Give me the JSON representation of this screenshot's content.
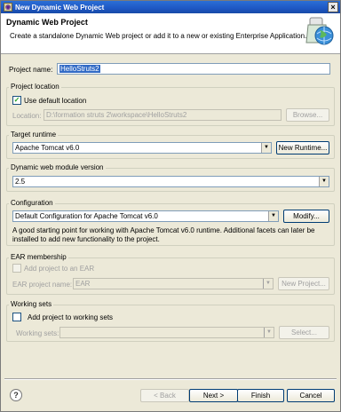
{
  "window": {
    "title": "New Dynamic Web Project"
  },
  "banner": {
    "heading": "Dynamic Web Project",
    "description": "Create a standalone Dynamic Web project or add it to a new or existing Enterprise Application."
  },
  "project_name": {
    "label": "Project name:",
    "value": "HelloStruts2"
  },
  "project_location": {
    "title": "Project location",
    "use_default_label": "Use default location",
    "use_default_checked": true,
    "location_label": "Location:",
    "location_value": "D:\\formation struts 2\\workspace\\HelloStruts2",
    "browse_label": "Browse..."
  },
  "target_runtime": {
    "title": "Target runtime",
    "value": "Apache Tomcat v6.0",
    "new_runtime_label": "New Runtime..."
  },
  "module_version": {
    "title": "Dynamic web module version",
    "value": "2.5"
  },
  "configuration": {
    "title": "Configuration",
    "value": "Default Configuration for Apache Tomcat v6.0",
    "modify_label": "Modify...",
    "info_line1": "A good starting point for working with Apache Tomcat v6.0 runtime. Additional facets can later be",
    "info_line2": "installed to add new functionality to the project."
  },
  "ear": {
    "title": "EAR membership",
    "add_label": "Add project to an EAR",
    "ear_name_label": "EAR project name:",
    "ear_value": "EAR",
    "new_project_label": "New Project..."
  },
  "working_sets": {
    "title": "Working sets",
    "add_label": "Add project to working sets",
    "sets_label": "Working sets:",
    "sets_value": "",
    "select_label": "Select..."
  },
  "footer": {
    "help": "?",
    "back_label": "< Back",
    "next_label": "Next >",
    "finish_label": "Finish",
    "cancel_label": "Cancel"
  }
}
